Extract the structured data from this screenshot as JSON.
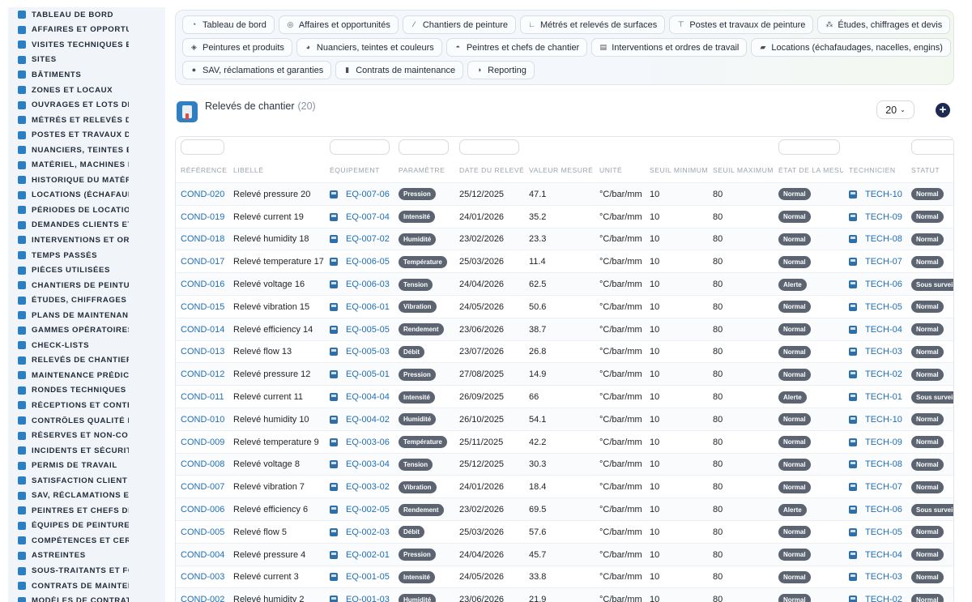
{
  "sidebar": {
    "items": [
      {
        "label": "TABLEAU DE BORD",
        "icon": "dashboard-icon"
      },
      {
        "label": "AFFAIRES ET OPPORTUNITÉS",
        "icon": "target-icon"
      },
      {
        "label": "VISITES TECHNIQUES ET RELEVÉS",
        "icon": "clipboard-icon"
      },
      {
        "label": "SITES",
        "icon": "map-pin-icon"
      },
      {
        "label": "BÂTIMENTS",
        "icon": "building-icon"
      },
      {
        "label": "ZONES ET LOCAUX",
        "icon": "grid-icon"
      },
      {
        "label": "OUVRAGES ET LOTS DE TRAVAUX",
        "icon": "sitemap-icon"
      },
      {
        "label": "MÉTRÉS ET RELEVÉS DE SURFACES",
        "icon": "ruler-icon"
      },
      {
        "label": "POSTES ET TRAVAUX DE PEINTURE",
        "icon": "paint-roller-icon"
      },
      {
        "label": "NUANCIERS, TEINTES ET COULEURS",
        "icon": "palette-icon"
      },
      {
        "label": "MATÉRIEL, MACHINES ET ENGINS",
        "icon": "cogs-icon"
      },
      {
        "label": "HISTORIQUE DU MATÉRIEL",
        "icon": "history-icon"
      },
      {
        "label": "LOCATIONS (ÉCHAFAUDAGES)",
        "icon": "truck-icon"
      },
      {
        "label": "PÉRIODES DE LOCATION",
        "icon": "calendar-icon"
      },
      {
        "label": "DEMANDES CLIENTS ET INTERVENTIONS",
        "icon": "file-icon"
      },
      {
        "label": "INTERVENTIONS ET ORDRES",
        "icon": "clipboard-check-icon"
      },
      {
        "label": "TEMPS PASSÉS",
        "icon": "clock-icon"
      },
      {
        "label": "PIÈCES UTILISÉES",
        "icon": "puzzle-icon"
      },
      {
        "label": "CHANTIERS DE PEINTURE",
        "icon": "brush-icon"
      },
      {
        "label": "ÉTUDES, CHIFFRAGES ET DEVIS",
        "icon": "calculator-icon"
      },
      {
        "label": "PLANS DE MAINTENANCE",
        "icon": "calendar-check-icon"
      },
      {
        "label": "GAMMES OPÉRATOIRES",
        "icon": "list-icon"
      },
      {
        "label": "CHECK-LISTS",
        "icon": "checklist-icon"
      },
      {
        "label": "RELEVÉS DE CHANTIER",
        "icon": "paint-roller-icon"
      },
      {
        "label": "MAINTENANCE PRÉDICTIVE",
        "icon": "chart-line-icon"
      },
      {
        "label": "RONDES TECHNIQUES",
        "icon": "route-icon"
      },
      {
        "label": "RÉCEPTIONS ET CONTRÔLES",
        "icon": "search-icon"
      },
      {
        "label": "CONTRÔLES QUALITÉ ET ESSAIS",
        "icon": "clipboard-icon"
      },
      {
        "label": "RÉSERVES ET NON-CONFORMITÉS",
        "icon": "alert-circle-icon"
      },
      {
        "label": "INCIDENTS ET SÉCURITÉ",
        "icon": "warning-icon"
      },
      {
        "label": "PERMIS DE TRAVAIL",
        "icon": "permit-icon"
      },
      {
        "label": "SATISFACTION CLIENT",
        "icon": "smile-icon"
      },
      {
        "label": "SAV, RÉCLAMATIONS ET GARANTIES",
        "icon": "comment-icon"
      },
      {
        "label": "PEINTRES ET CHEFS DE CHANTIER",
        "icon": "comments-icon"
      },
      {
        "label": "ÉQUIPES DE PEINTURE",
        "icon": "users-icon"
      },
      {
        "label": "COMPÉTENCES ET CERTIFICATIONS",
        "icon": "certificate-icon"
      },
      {
        "label": "ASTREINTES",
        "icon": "phone-icon"
      },
      {
        "label": "SOUS-TRAITANTS ET FOURNISSEURS",
        "icon": "handshake-icon"
      },
      {
        "label": "CONTRATS DE MAINTENANCE",
        "icon": "file-contract-icon"
      },
      {
        "label": "MODÈLES DE CONTRATS",
        "icon": "file-icon"
      }
    ]
  },
  "topnav": {
    "rows": [
      [
        {
          "label": "Tableau de bord",
          "icon": "dashboard-icon",
          "glyph": "◔"
        },
        {
          "label": "Affaires et opportunités",
          "icon": "target-icon",
          "glyph": "◎"
        },
        {
          "label": "Chantiers de peinture",
          "icon": "brush-icon",
          "glyph": "⁄"
        },
        {
          "label": "Métrés et relevés de surfaces",
          "icon": "ruler-icon",
          "glyph": "∟"
        },
        {
          "label": "Postes et travaux de peinture",
          "icon": "paint-roller-icon",
          "glyph": "⊤"
        },
        {
          "label": "Études, chiffrages et devis",
          "icon": "sitemap-icon",
          "glyph": "⁂"
        }
      ],
      [
        {
          "label": "Peintures et produits",
          "icon": "fill-icon",
          "glyph": "◈"
        },
        {
          "label": "Nuanciers, teintes et couleurs",
          "icon": "palette-icon",
          "glyph": "◕"
        },
        {
          "label": "Peintres et chefs de chantier",
          "icon": "helmet-icon",
          "glyph": "◓"
        },
        {
          "label": "Interventions et ordres de travail",
          "icon": "clipboard-icon",
          "glyph": "▤"
        },
        {
          "label": "Locations (échafaudages, nacelles, engins)",
          "icon": "truck-icon",
          "glyph": "▰"
        }
      ],
      [
        {
          "label": "SAV, réclamations et garanties",
          "icon": "comment-icon",
          "glyph": "●"
        },
        {
          "label": "Contrats de maintenance",
          "icon": "file-contract-icon",
          "glyph": "▮"
        },
        {
          "label": "Reporting",
          "icon": "chart-pie-icon",
          "glyph": "◑"
        }
      ]
    ]
  },
  "header": {
    "title": "Relevés de chantier",
    "count": "(20)",
    "per_page": "20"
  },
  "table": {
    "columns": [
      "RÉFÉRENCE",
      "LIBELLÉ",
      "ÉQUIPEMENT",
      "PARAMÈTRE",
      "DATE DU RELEVÉ",
      "VALEUR MESURÉE",
      "UNITÉ",
      "SEUIL MINIMUM",
      "SEUIL MAXIMUM",
      "ÉTAT DE LA MESURE",
      "TECHNICIEN",
      "STATUT"
    ],
    "rows": [
      {
        "ref": "COND-020",
        "label": "Relevé pressure 20",
        "eq": "EQ-007-06",
        "param": "Pression",
        "date": "25/12/2025",
        "value": "47.1",
        "unit": "°C/bar/mm",
        "min": "10",
        "max": "80",
        "state": "Normal",
        "tech": "TECH-10",
        "status": "Normal"
      },
      {
        "ref": "COND-019",
        "label": "Relevé current 19",
        "eq": "EQ-007-04",
        "param": "Intensité",
        "date": "24/01/2026",
        "value": "35.2",
        "unit": "°C/bar/mm",
        "min": "10",
        "max": "80",
        "state": "Normal",
        "tech": "TECH-09",
        "status": "Normal"
      },
      {
        "ref": "COND-018",
        "label": "Relevé humidity 18",
        "eq": "EQ-007-02",
        "param": "Humidité",
        "date": "23/02/2026",
        "value": "23.3",
        "unit": "°C/bar/mm",
        "min": "10",
        "max": "80",
        "state": "Normal",
        "tech": "TECH-08",
        "status": "Normal"
      },
      {
        "ref": "COND-017",
        "label": "Relevé temperature 17",
        "eq": "EQ-006-05",
        "param": "Température",
        "date": "25/03/2026",
        "value": "11.4",
        "unit": "°C/bar/mm",
        "min": "10",
        "max": "80",
        "state": "Normal",
        "tech": "TECH-07",
        "status": "Normal"
      },
      {
        "ref": "COND-016",
        "label": "Relevé voltage 16",
        "eq": "EQ-006-03",
        "param": "Tension",
        "date": "24/04/2026",
        "value": "62.5",
        "unit": "°C/bar/mm",
        "min": "10",
        "max": "80",
        "state": "Alerte",
        "tech": "TECH-06",
        "status": "Sous surveillance"
      },
      {
        "ref": "COND-015",
        "label": "Relevé vibration 15",
        "eq": "EQ-006-01",
        "param": "Vibration",
        "date": "24/05/2026",
        "value": "50.6",
        "unit": "°C/bar/mm",
        "min": "10",
        "max": "80",
        "state": "Normal",
        "tech": "TECH-05",
        "status": "Normal"
      },
      {
        "ref": "COND-014",
        "label": "Relevé efficiency 14",
        "eq": "EQ-005-05",
        "param": "Rendement",
        "date": "23/06/2026",
        "value": "38.7",
        "unit": "°C/bar/mm",
        "min": "10",
        "max": "80",
        "state": "Normal",
        "tech": "TECH-04",
        "status": "Normal"
      },
      {
        "ref": "COND-013",
        "label": "Relevé flow 13",
        "eq": "EQ-005-03",
        "param": "Débit",
        "date": "23/07/2026",
        "value": "26.8",
        "unit": "°C/bar/mm",
        "min": "10",
        "max": "80",
        "state": "Normal",
        "tech": "TECH-03",
        "status": "Normal"
      },
      {
        "ref": "COND-012",
        "label": "Relevé pressure 12",
        "eq": "EQ-005-01",
        "param": "Pression",
        "date": "27/08/2025",
        "value": "14.9",
        "unit": "°C/bar/mm",
        "min": "10",
        "max": "80",
        "state": "Normal",
        "tech": "TECH-02",
        "status": "Normal"
      },
      {
        "ref": "COND-011",
        "label": "Relevé current 11",
        "eq": "EQ-004-04",
        "param": "Intensité",
        "date": "26/09/2025",
        "value": "66",
        "unit": "°C/bar/mm",
        "min": "10",
        "max": "80",
        "state": "Alerte",
        "tech": "TECH-01",
        "status": "Sous surveillance"
      },
      {
        "ref": "COND-010",
        "label": "Relevé humidity 10",
        "eq": "EQ-004-02",
        "param": "Humidité",
        "date": "26/10/2025",
        "value": "54.1",
        "unit": "°C/bar/mm",
        "min": "10",
        "max": "80",
        "state": "Normal",
        "tech": "TECH-10",
        "status": "Normal"
      },
      {
        "ref": "COND-009",
        "label": "Relevé temperature 9",
        "eq": "EQ-003-06",
        "param": "Température",
        "date": "25/11/2025",
        "value": "42.2",
        "unit": "°C/bar/mm",
        "min": "10",
        "max": "80",
        "state": "Normal",
        "tech": "TECH-09",
        "status": "Normal"
      },
      {
        "ref": "COND-008",
        "label": "Relevé voltage 8",
        "eq": "EQ-003-04",
        "param": "Tension",
        "date": "25/12/2025",
        "value": "30.3",
        "unit": "°C/bar/mm",
        "min": "10",
        "max": "80",
        "state": "Normal",
        "tech": "TECH-08",
        "status": "Normal"
      },
      {
        "ref": "COND-007",
        "label": "Relevé vibration 7",
        "eq": "EQ-003-02",
        "param": "Vibration",
        "date": "24/01/2026",
        "value": "18.4",
        "unit": "°C/bar/mm",
        "min": "10",
        "max": "80",
        "state": "Normal",
        "tech": "TECH-07",
        "status": "Normal"
      },
      {
        "ref": "COND-006",
        "label": "Relevé efficiency 6",
        "eq": "EQ-002-05",
        "param": "Rendement",
        "date": "23/02/2026",
        "value": "69.5",
        "unit": "°C/bar/mm",
        "min": "10",
        "max": "80",
        "state": "Alerte",
        "tech": "TECH-06",
        "status": "Sous surveillance"
      },
      {
        "ref": "COND-005",
        "label": "Relevé flow 5",
        "eq": "EQ-002-03",
        "param": "Débit",
        "date": "25/03/2026",
        "value": "57.6",
        "unit": "°C/bar/mm",
        "min": "10",
        "max": "80",
        "state": "Normal",
        "tech": "TECH-05",
        "status": "Normal"
      },
      {
        "ref": "COND-004",
        "label": "Relevé pressure 4",
        "eq": "EQ-002-01",
        "param": "Pression",
        "date": "24/04/2026",
        "value": "45.7",
        "unit": "°C/bar/mm",
        "min": "10",
        "max": "80",
        "state": "Normal",
        "tech": "TECH-04",
        "status": "Normal"
      },
      {
        "ref": "COND-003",
        "label": "Relevé current 3",
        "eq": "EQ-001-05",
        "param": "Intensité",
        "date": "24/05/2026",
        "value": "33.8",
        "unit": "°C/bar/mm",
        "min": "10",
        "max": "80",
        "state": "Normal",
        "tech": "TECH-03",
        "status": "Normal"
      },
      {
        "ref": "COND-002",
        "label": "Relevé humidity 2",
        "eq": "EQ-001-03",
        "param": "Humidité",
        "date": "23/06/2026",
        "value": "21.9",
        "unit": "°C/bar/mm",
        "min": "10",
        "max": "80",
        "state": "Normal",
        "tech": "TECH-02",
        "status": "Normal"
      }
    ]
  },
  "colors": {
    "accent": "#1f6fb5",
    "sidebar_bg": "#f1f4f9",
    "pill": "#5b6470",
    "add_button": "#1d2b53"
  }
}
